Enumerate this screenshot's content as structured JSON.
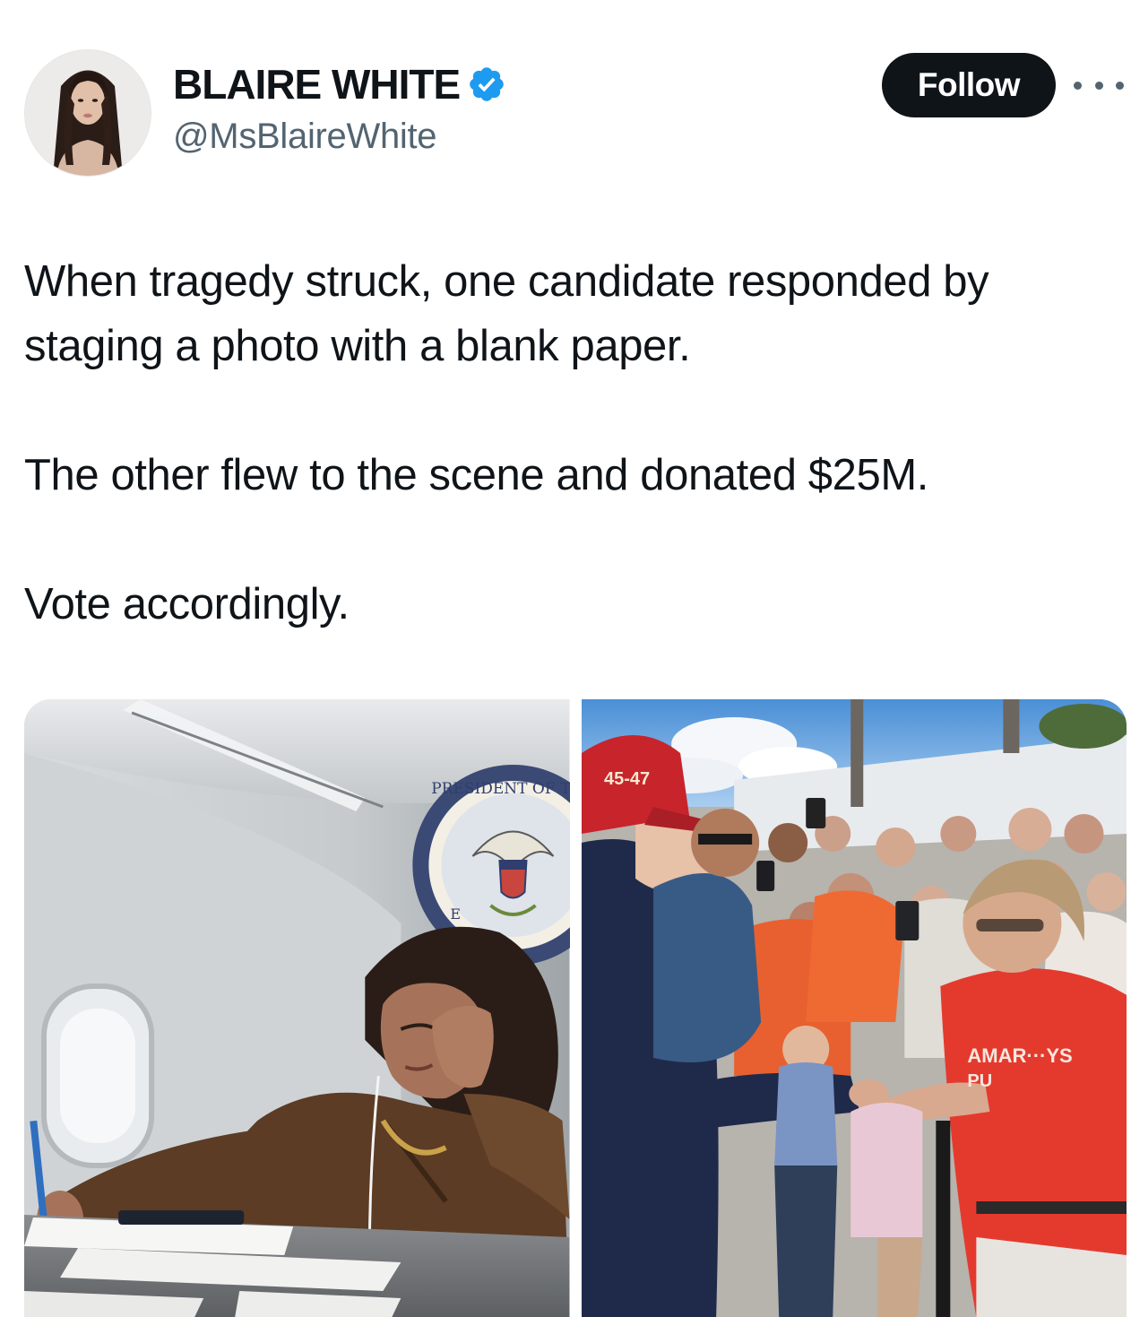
{
  "author": {
    "display_name": "BLAIRE WHITE",
    "handle": "@MsBlaireWhite",
    "verified": true,
    "verified_icon": "verified-badge-icon",
    "verified_color": "#1d9bf0"
  },
  "actions": {
    "follow_label": "Follow",
    "more_icon": "more-horizontal-icon"
  },
  "tweet": {
    "paragraphs": [
      "When tragedy struck, one candidate responded by staging a photo with a blank paper.",
      "The other flew to the scene and donated $25M.",
      "Vote accordingly."
    ]
  },
  "media": {
    "left_photo": {
      "seal_text": "PRESIDENT OF THE",
      "seal_text_lower": "E"
    },
    "right_photo": {
      "cap_text": "45-47",
      "shirt_text_1": "AMAR···YS",
      "shirt_text_2": "PU"
    }
  },
  "colors": {
    "text_primary": "#0f1419",
    "text_secondary": "#536471",
    "follow_bg": "#0f1419",
    "follow_text": "#ffffff"
  }
}
